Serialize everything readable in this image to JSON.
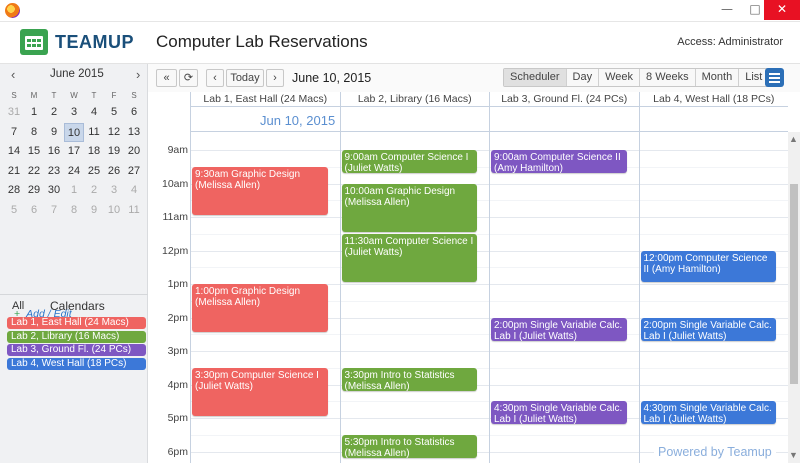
{
  "window": {
    "minimize": "—",
    "maximize": "□",
    "close": "✕"
  },
  "header": {
    "logo": "TEAMUP",
    "title": "Computer Lab Reservations",
    "access": "Access: Administrator"
  },
  "mini_calendar": {
    "month": "June 2015",
    "prev": "‹",
    "next": "›",
    "weekdays": [
      "S",
      "M",
      "T",
      "W",
      "T",
      "F",
      "S"
    ],
    "weeks": [
      [
        "31",
        "1",
        "2",
        "3",
        "4",
        "5",
        "6"
      ],
      [
        "7",
        "8",
        "9",
        "10",
        "11",
        "12",
        "13"
      ],
      [
        "14",
        "15",
        "16",
        "17",
        "18",
        "19",
        "20"
      ],
      [
        "21",
        "22",
        "23",
        "24",
        "25",
        "26",
        "27"
      ],
      [
        "28",
        "29",
        "30",
        "1",
        "2",
        "3",
        "4"
      ],
      [
        "5",
        "6",
        "7",
        "8",
        "9",
        "10",
        "11"
      ]
    ],
    "today": "10"
  },
  "calendars": {
    "all": "All",
    "title": "Calendars",
    "items": [
      {
        "label": "Lab 1, East Hall (24 Macs)",
        "color": "#ef6461"
      },
      {
        "label": "Lab 2, Library (16 Macs)",
        "color": "#6fa83f"
      },
      {
        "label": "Lab 3, Ground Fl. (24 PCs)",
        "color": "#7e57c2"
      },
      {
        "label": "Lab 4, West Hall (18 PCs)",
        "color": "#3c78d8"
      }
    ],
    "add_edit": "Add / Edit"
  },
  "toolbar": {
    "first": "«",
    "refresh": "⟳",
    "prev": "‹",
    "today": "Today",
    "next": "›",
    "date": "June 10, 2015",
    "views": [
      "Scheduler",
      "Day",
      "Week",
      "8 Weeks",
      "Month",
      "List"
    ],
    "active_view": "Scheduler"
  },
  "grid": {
    "columns": [
      "Lab 1, East Hall (24 Macs)",
      "Lab 2, Library (16 Macs)",
      "Lab 3, Ground Fl. (24 PCs)",
      "Lab 4, West Hall (18 PCs)"
    ],
    "allday_date": "Jun 10, 2015",
    "hours": [
      "9am",
      "10am",
      "11am",
      "12pm",
      "1pm",
      "2pm",
      "3pm",
      "4pm",
      "5pm",
      "6pm"
    ],
    "scroll_up": "▲",
    "scroll_down": "▼"
  },
  "events": [
    {
      "col": 0,
      "start": 9.5,
      "end": 11.0,
      "color": "#ef6461",
      "text": "9:30am Graphic Design (Melissa Allen)"
    },
    {
      "col": 0,
      "start": 13.0,
      "end": 14.5,
      "color": "#ef6461",
      "text": "1:00pm Graphic Design (Melissa Allen)"
    },
    {
      "col": 0,
      "start": 15.5,
      "end": 17.0,
      "color": "#ef6461",
      "text": "3:30pm Computer Science I (Juliet Watts)"
    },
    {
      "col": 1,
      "start": 9.0,
      "end": 9.75,
      "color": "#6fa83f",
      "text": "9:00am Computer Science I (Juliet Watts)"
    },
    {
      "col": 1,
      "start": 10.0,
      "end": 11.5,
      "color": "#6fa83f",
      "text": "10:00am Graphic Design (Melissa Allen)"
    },
    {
      "col": 1,
      "start": 11.5,
      "end": 13.0,
      "color": "#6fa83f",
      "text": "11:30am Computer Science I (Juliet Watts)"
    },
    {
      "col": 1,
      "start": 15.5,
      "end": 16.25,
      "color": "#6fa83f",
      "text": "3:30pm Intro to Statistics (Melissa Allen)"
    },
    {
      "col": 1,
      "start": 17.5,
      "end": 18.25,
      "color": "#6fa83f",
      "text": "5:30pm Intro to Statistics (Melissa Allen)"
    },
    {
      "col": 2,
      "start": 9.0,
      "end": 9.75,
      "color": "#7e57c2",
      "text": "9:00am Computer Science II (Amy Hamilton)"
    },
    {
      "col": 2,
      "start": 14.0,
      "end": 14.75,
      "color": "#7e57c2",
      "text": "2:00pm Single Variable Calc. Lab I (Juliet Watts)"
    },
    {
      "col": 2,
      "start": 16.5,
      "end": 17.25,
      "color": "#7e57c2",
      "text": "4:30pm Single Variable Calc. Lab I (Juliet Watts)"
    },
    {
      "col": 3,
      "start": 12.0,
      "end": 13.0,
      "color": "#3c78d8",
      "text": "12:00pm Computer Science II (Amy Hamilton)"
    },
    {
      "col": 3,
      "start": 14.0,
      "end": 14.75,
      "color": "#3c78d8",
      "text": "2:00pm Single Variable Calc. Lab I (Juliet Watts)"
    },
    {
      "col": 3,
      "start": 16.5,
      "end": 17.25,
      "color": "#3c78d8",
      "text": "4:30pm Single Variable Calc. Lab I (Juliet Watts)"
    }
  ],
  "footer": {
    "powered": "Powered by Teamup"
  }
}
